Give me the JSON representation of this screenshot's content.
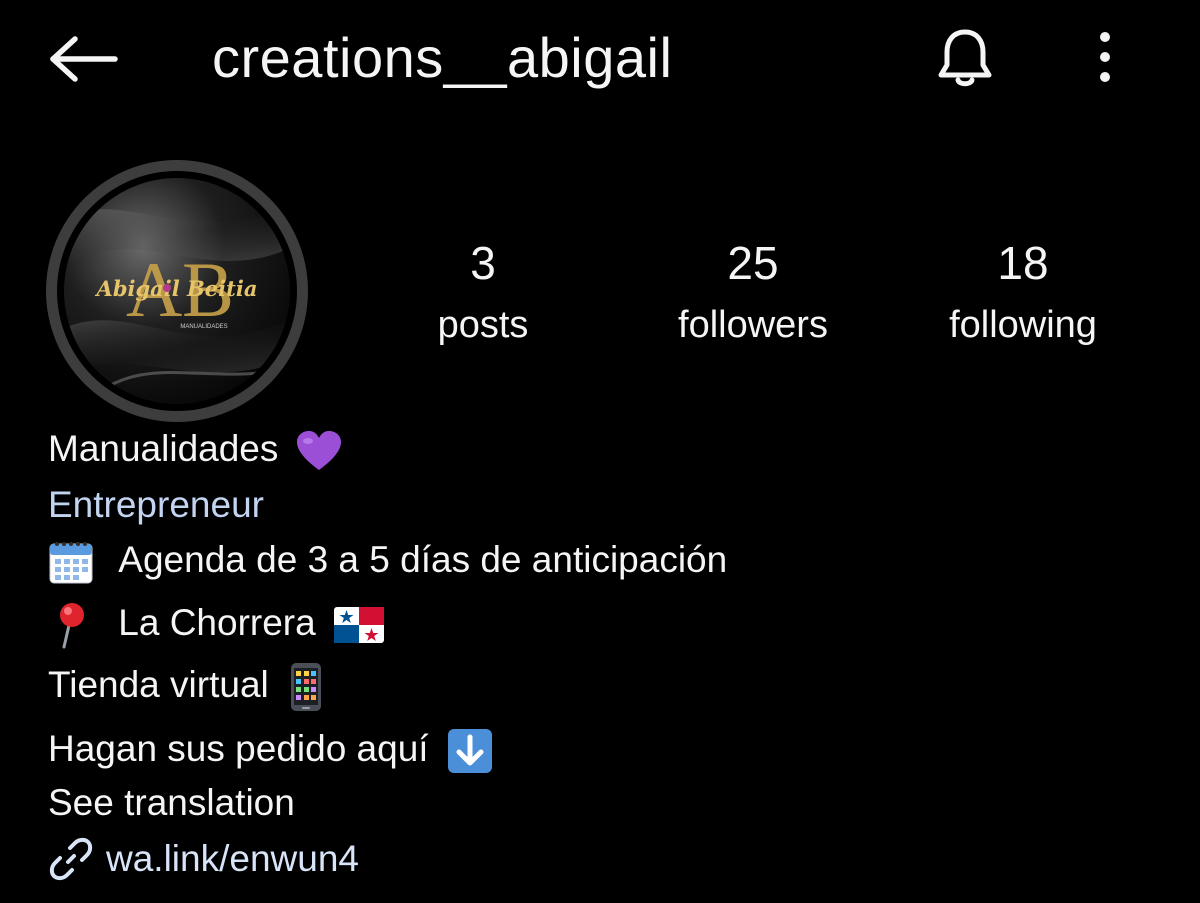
{
  "header": {
    "username": "creations__abigail",
    "back_icon": "arrow-left-icon",
    "notifications_icon": "bell-icon",
    "menu_icon": "more-vertical-icon"
  },
  "profile": {
    "avatar_icon": "profile-logo",
    "avatar_logo_text": "Abigail Beitia",
    "avatar_logo_subtext": "MANUALIDADES"
  },
  "stats": [
    {
      "count": "3",
      "label": "posts"
    },
    {
      "count": "25",
      "label": "followers"
    },
    {
      "count": "18",
      "label": "following"
    }
  ],
  "bio": {
    "name": "Manualidades",
    "category": "Entrepreneur",
    "lines": [
      "Agenda de 3 a 5 días de anticipación",
      "La Chorrera",
      "Tienda virtual",
      "Hagan sus pedido aquí"
    ],
    "line_icons": [
      "purple-heart-icon",
      "calendar-icon",
      "pin-icon",
      "panama-flag-icon",
      "mobile-phone-icon",
      "down-arrow-icon"
    ],
    "translation_label": "See translation"
  },
  "link": {
    "icon": "link-icon",
    "text": "wa.link/enwun4"
  },
  "colors": {
    "background": "#000000",
    "text": "#f5f5f5",
    "category": "#c2d4f0",
    "link": "#d8e4f7",
    "heart": "#9b4fd6",
    "avatar_ring": "#3d3d3d",
    "logo_gold": "#c9a24a"
  }
}
